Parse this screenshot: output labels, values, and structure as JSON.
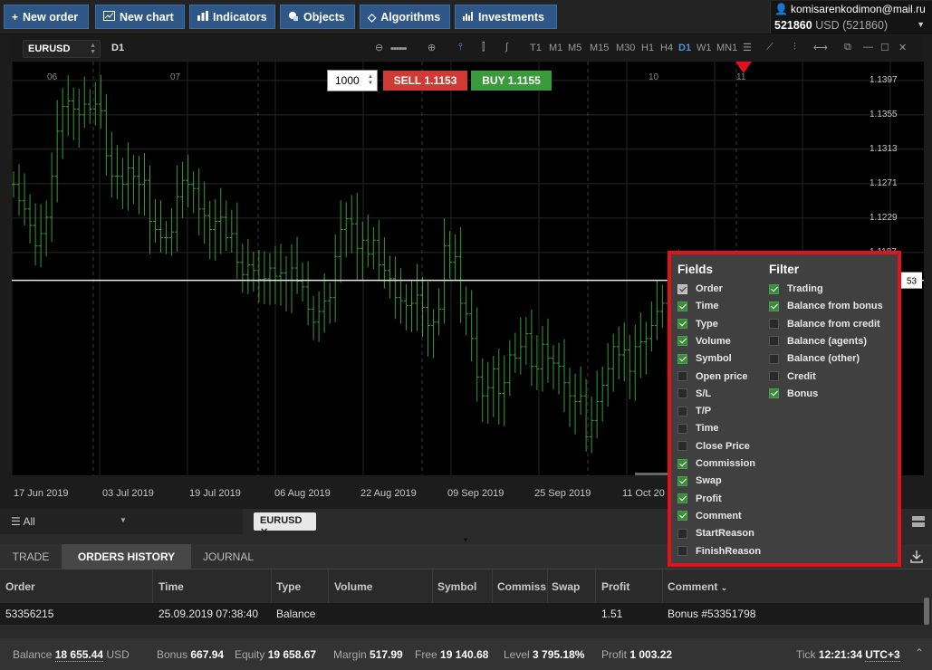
{
  "toolbar": {
    "new_order": "New order",
    "new_chart": "New chart",
    "indicators": "Indicators",
    "objects": "Objects",
    "algorithms": "Algorithms",
    "investments": "Investments"
  },
  "account": {
    "email": "komisarenkodimon@mail.ru",
    "number": "521860",
    "currency_label": "USD (521860)"
  },
  "chart_header": {
    "symbol": "EURUSD",
    "timeframe": "D1",
    "timeframes": [
      "T1",
      "M1",
      "M5",
      "M15",
      "M30",
      "H1",
      "H4",
      "D1",
      "W1",
      "MN1"
    ],
    "active_timeframe": "D1"
  },
  "trade": {
    "quantity": "1000",
    "sell": "SELL 1.1153",
    "buy": "BUY 1.1155"
  },
  "chart_data": {
    "type": "ohlc",
    "symbol": "EURUSD",
    "timeframe": "D1",
    "top_labels": [
      "06",
      "07",
      "10",
      "11"
    ],
    "price_labels": [
      "1.1397",
      "1.1355",
      "1.1313",
      "1.1271",
      "1.1229",
      "1.1187"
    ],
    "current_price_tag": "53",
    "date_labels": [
      "17 Jun 2019",
      "03 Jul 2019",
      "19 Jul 2019",
      "06 Aug 2019",
      "22 Aug 2019",
      "09 Sep 2019",
      "25 Sep 2019",
      "11 Oct 20"
    ],
    "ylim": [
      1.0915,
      1.142
    ],
    "bar_color": "#3a9a3a",
    "closes": [
      1.127,
      1.125,
      1.124,
      1.122,
      1.1195,
      1.121,
      1.123,
      1.128,
      1.1335,
      1.1365,
      1.1372,
      1.1362,
      1.1355,
      1.1368,
      1.1362,
      1.1368,
      1.136,
      1.1305,
      1.128,
      1.128,
      1.127,
      1.129,
      1.128,
      1.127,
      1.1275,
      1.1225,
      1.1215,
      1.1205,
      1.1205,
      1.1212,
      1.1255,
      1.1275,
      1.127,
      1.1265,
      1.124,
      1.1232,
      1.1215,
      1.1225,
      1.123,
      1.1205,
      1.121,
      1.1175,
      1.116,
      1.1172,
      1.1165,
      1.1154,
      1.1155,
      1.1168,
      1.1158,
      1.1162,
      1.1153,
      1.1168,
      1.1152,
      1.1145,
      1.1118,
      1.1102,
      1.1115,
      1.1128,
      1.1132,
      1.1182,
      1.1215,
      1.1228,
      1.1222,
      1.1192,
      1.1202,
      1.1185,
      1.1202,
      1.1172,
      1.1165,
      1.1155,
      1.1132,
      1.1128,
      1.1122,
      1.1125,
      1.1135,
      1.112,
      1.1098,
      1.1102,
      1.1118,
      1.1195,
      1.1175,
      1.1182,
      1.1125,
      1.1112,
      1.1082,
      1.1035,
      1.1012,
      1.1022,
      1.1045,
      1.1015,
      1.1028,
      1.1062,
      1.1058,
      1.1072,
      1.1088,
      1.1048,
      1.1045,
      1.1075,
      1.1058,
      1.1052,
      1.1048,
      1.1028,
      1.1012,
      1.1005,
      1.1012,
      1.0962,
      1.0982,
      1.1005,
      1.1025,
      1.1045,
      1.1072,
      1.1062,
      1.1068,
      1.1042,
      1.1072,
      1.1078,
      1.1082,
      1.1098,
      1.1115,
      1.1125,
      1.1155,
      1.1152,
      1.1165
    ]
  },
  "fields_popup": {
    "fields_title": "Fields",
    "filter_title": "Filter",
    "fields": [
      {
        "label": "Order",
        "state": "locked"
      },
      {
        "label": "Time",
        "state": "on"
      },
      {
        "label": "Type",
        "state": "on"
      },
      {
        "label": "Volume",
        "state": "on"
      },
      {
        "label": "Symbol",
        "state": "on"
      },
      {
        "label": "Open price",
        "state": "off"
      },
      {
        "label": "S/L",
        "state": "off"
      },
      {
        "label": "T/P",
        "state": "off"
      },
      {
        "label": "Time",
        "state": "off"
      },
      {
        "label": "Close Price",
        "state": "off"
      },
      {
        "label": "Commission",
        "state": "on"
      },
      {
        "label": "Swap",
        "state": "on"
      },
      {
        "label": "Profit",
        "state": "on"
      },
      {
        "label": "Comment",
        "state": "on"
      },
      {
        "label": "StartReason",
        "state": "off"
      },
      {
        "label": "FinishReason",
        "state": "off"
      }
    ],
    "filters": [
      {
        "label": "Trading",
        "state": "on"
      },
      {
        "label": "Balance from bonus",
        "state": "on"
      },
      {
        "label": "Balance from credit",
        "state": "off"
      },
      {
        "label": "Balance (agents)",
        "state": "off"
      },
      {
        "label": "Balance (other)",
        "state": "off"
      },
      {
        "label": "Credit",
        "state": "off"
      },
      {
        "label": "Bonus",
        "state": "on"
      }
    ]
  },
  "panel": {
    "all_label": "All",
    "chip": "EURUSD",
    "tabs": [
      "TRADE",
      "ORDERS HISTORY",
      "JOURNAL"
    ],
    "active_tab": "ORDERS HISTORY",
    "columns": [
      "Order",
      "Time",
      "Type",
      "Volume",
      "Symbol",
      "Commiss",
      "Swap",
      "Profit",
      "Comment"
    ],
    "rows": [
      {
        "order": "53356215",
        "time": "25.09.2019 07:38:40",
        "type": "Balance",
        "volume": "",
        "symbol": "",
        "commission": "",
        "swap": "",
        "profit": "1.51",
        "comment": "Bonus #53351798"
      }
    ]
  },
  "status": {
    "balance_label": "Balance",
    "balance": "18 655.44",
    "balance_cur": "USD",
    "bonus_label": "Bonus",
    "bonus": "667.94",
    "equity_label": "Equity",
    "equity": "19 658.67",
    "margin_label": "Margin",
    "margin": "517.99",
    "free_label": "Free",
    "free": "19 140.68",
    "level_label": "Level",
    "level": "3 795.18%",
    "profit_label": "Profit",
    "profit": "1 003.22",
    "tick_label": "Tick",
    "tick": "12:21:34",
    "utc": "UTC+3"
  }
}
